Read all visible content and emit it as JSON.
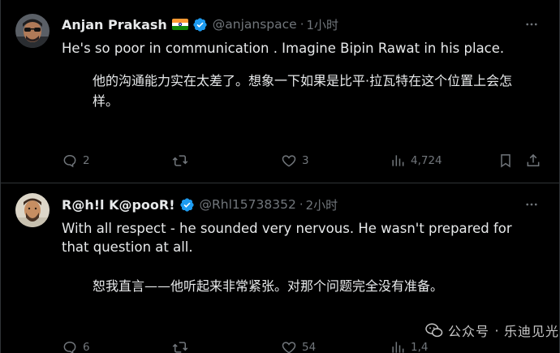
{
  "tweets": [
    {
      "display_name": "Anjan Prakash",
      "flag": "india-flag",
      "verified": true,
      "handle": "@anjanspace",
      "separator": "·",
      "time": "1小时",
      "text_en": "He's so poor in communication . Imagine Bipin Rawat in his place.",
      "text_zh": "他的沟通能力实在太差了。想象一下如果是比平·拉瓦特在这个位置上会怎样。",
      "actions": {
        "replies": "2",
        "reposts": "",
        "likes": "3",
        "views": "4,724"
      }
    },
    {
      "display_name": "R@h!l K@pooR!",
      "verified": true,
      "handle": "@Rhl15738352",
      "separator": "·",
      "time": "2小时",
      "text_en": "With all respect - he sounded very nervous. He wasn't prepared for that question at all.",
      "text_zh": "恕我直言——他听起来非常紧张。对那个问题完全没有准备。",
      "actions": {
        "replies": "6",
        "reposts": "",
        "likes": "54",
        "views": "1,4"
      }
    }
  ],
  "watermark": {
    "platform": "公众号",
    "separator": "·",
    "account": "乐迪见光"
  },
  "colors": {
    "background": "#000000",
    "text_primary": "#e7e9ea",
    "text_secondary": "#71767b",
    "divider": "#2f3336",
    "verified_blue": "#1d9bf0"
  }
}
